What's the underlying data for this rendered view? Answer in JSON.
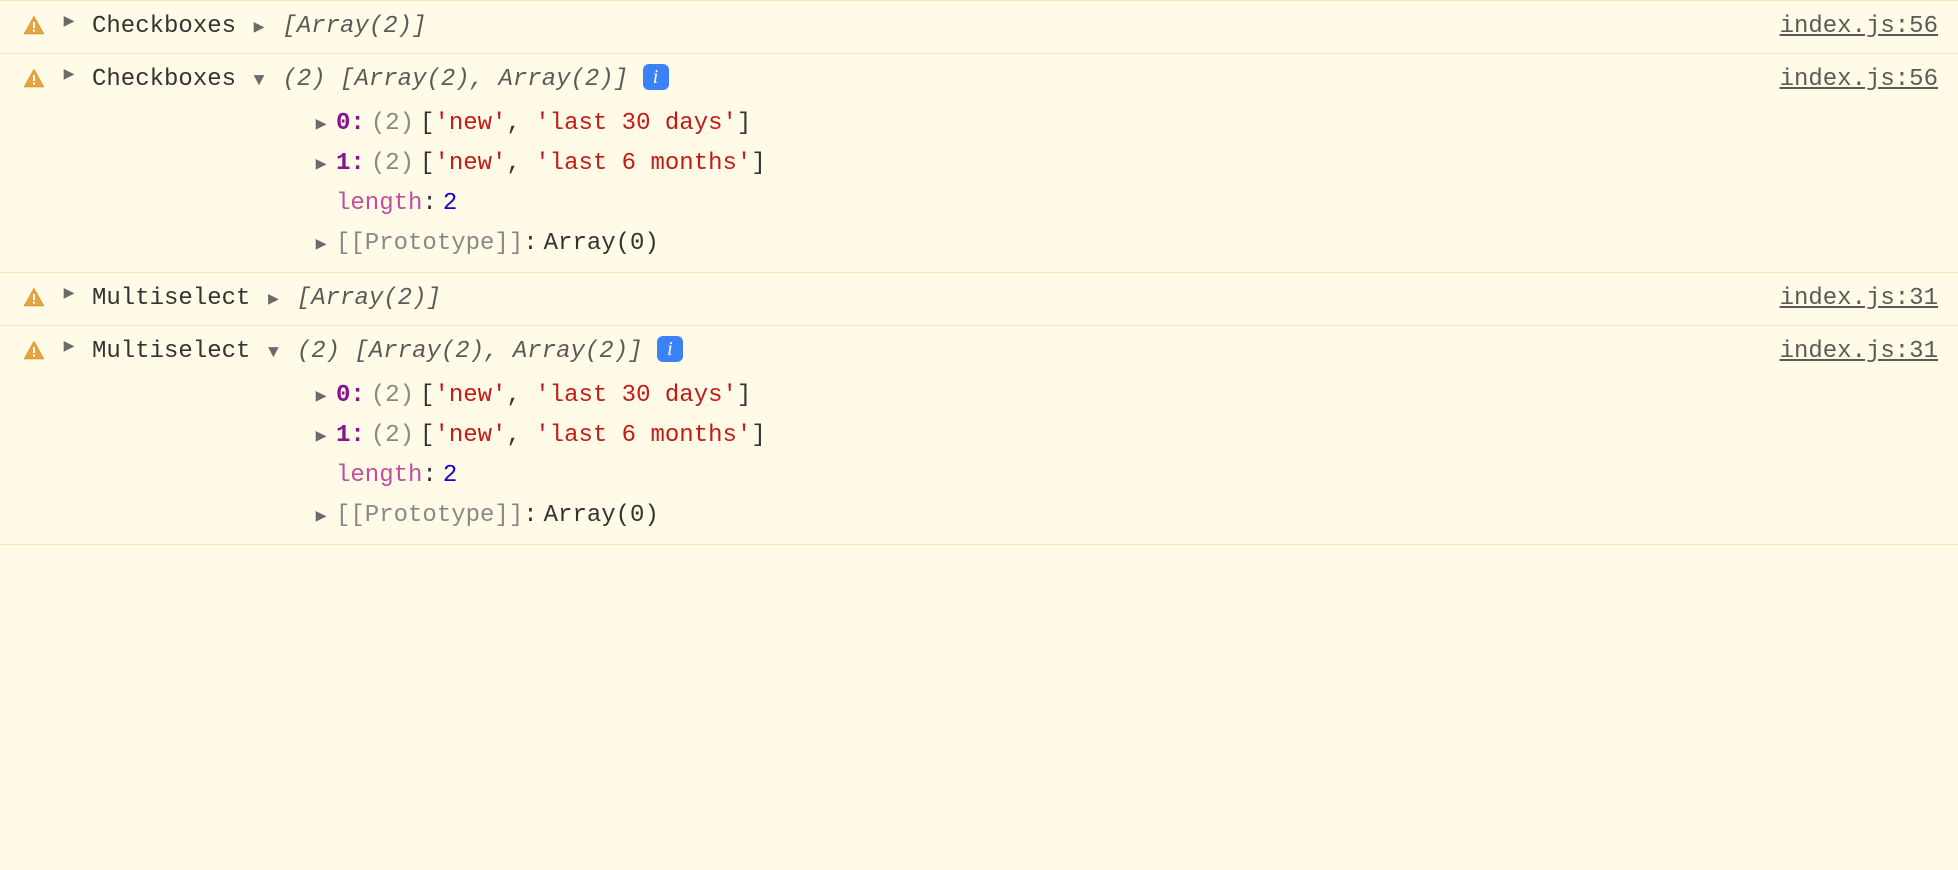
{
  "entries": [
    {
      "label": "Checkboxes",
      "source": "index.js:56",
      "preview": "[Array(2)]",
      "expanded": false
    },
    {
      "label": "Checkboxes",
      "source": "index.js:56",
      "preview_count": "(2)",
      "preview_body": "[Array(2), Array(2)]",
      "expanded": true,
      "items": [
        {
          "index": "0",
          "count": "(2)",
          "values": [
            "'new'",
            "'last 30 days'"
          ]
        },
        {
          "index": "1",
          "count": "(2)",
          "values": [
            "'new'",
            "'last 6 months'"
          ]
        }
      ],
      "length_key": "length",
      "length_val": "2",
      "proto_key": "[[Prototype]]",
      "proto_val": "Array(0)"
    },
    {
      "label": "Multiselect",
      "source": "index.js:31",
      "preview": "[Array(2)]",
      "expanded": false
    },
    {
      "label": "Multiselect",
      "source": "index.js:31",
      "preview_count": "(2)",
      "preview_body": "[Array(2), Array(2)]",
      "expanded": true,
      "items": [
        {
          "index": "0",
          "count": "(2)",
          "values": [
            "'new'",
            "'last 30 days'"
          ]
        },
        {
          "index": "1",
          "count": "(2)",
          "values": [
            "'new'",
            "'last 6 months'"
          ]
        }
      ],
      "length_key": "length",
      "length_val": "2",
      "proto_key": "[[Prototype]]",
      "proto_val": "Array(0)"
    }
  ],
  "info_glyph": "i",
  "colon": ":"
}
